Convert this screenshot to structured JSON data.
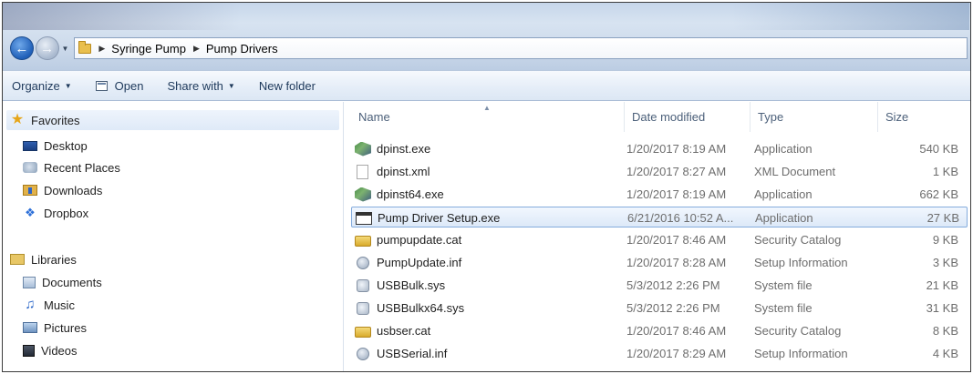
{
  "address": {
    "breadcrumbs": [
      "Syringe Pump",
      "Pump Drivers"
    ]
  },
  "toolbar": {
    "organize_label": "Organize",
    "open_label": "Open",
    "share_label": "Share with",
    "new_folder_label": "New folder"
  },
  "navpane": {
    "favorites_label": "Favorites",
    "favorites": [
      {
        "label": "Desktop",
        "icon": "desktop-icon"
      },
      {
        "label": "Recent Places",
        "icon": "recent-places-icon"
      },
      {
        "label": "Downloads",
        "icon": "downloads-icon"
      },
      {
        "label": "Dropbox",
        "icon": "dropbox-icon"
      }
    ],
    "libraries_label": "Libraries",
    "libraries": [
      {
        "label": "Documents",
        "icon": "documents-icon"
      },
      {
        "label": "Music",
        "icon": "music-icon"
      },
      {
        "label": "Pictures",
        "icon": "pictures-icon"
      },
      {
        "label": "Videos",
        "icon": "videos-icon"
      }
    ]
  },
  "filelist": {
    "columns": {
      "name": "Name",
      "date": "Date modified",
      "type": "Type",
      "size": "Size"
    },
    "files": [
      {
        "name": "dpinst.exe",
        "date": "1/20/2017 8:19 AM",
        "type": "Application",
        "size": "540 KB",
        "icon": "exe-icon"
      },
      {
        "name": "dpinst.xml",
        "date": "1/20/2017 8:27 AM",
        "type": "XML Document",
        "size": "1 KB",
        "icon": "xml-file-icon"
      },
      {
        "name": "dpinst64.exe",
        "date": "1/20/2017 8:19 AM",
        "type": "Application",
        "size": "662 KB",
        "icon": "exe-icon"
      },
      {
        "name": "Pump Driver Setup.exe",
        "date": "6/21/2016 10:52 A...",
        "type": "Application",
        "size": "27 KB",
        "icon": "application-window-icon",
        "selected": true
      },
      {
        "name": "pumpupdate.cat",
        "date": "1/20/2017 8:46 AM",
        "type": "Security Catalog",
        "size": "9 KB",
        "icon": "security-catalog-icon"
      },
      {
        "name": "PumpUpdate.inf",
        "date": "1/20/2017 8:28 AM",
        "type": "Setup Information",
        "size": "3 KB",
        "icon": "setup-information-icon"
      },
      {
        "name": "USBBulk.sys",
        "date": "5/3/2012 2:26 PM",
        "type": "System file",
        "size": "21 KB",
        "icon": "system-file-icon"
      },
      {
        "name": "USBBulkx64.sys",
        "date": "5/3/2012 2:26 PM",
        "type": "System file",
        "size": "31 KB",
        "icon": "system-file-icon"
      },
      {
        "name": "usbser.cat",
        "date": "1/20/2017 8:46 AM",
        "type": "Security Catalog",
        "size": "8 KB",
        "icon": "security-catalog-icon"
      },
      {
        "name": "USBSerial.inf",
        "date": "1/20/2017 8:29 AM",
        "type": "Setup Information",
        "size": "4 KB",
        "icon": "setup-information-icon"
      }
    ]
  },
  "colors": {
    "selection_fill": "#dde9f8",
    "selection_border": "#84acdd",
    "toolbar_text": "#1e395b"
  }
}
